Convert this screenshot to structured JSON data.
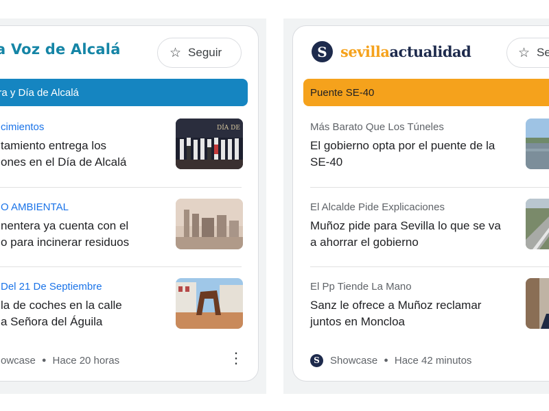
{
  "card1": {
    "brand": "a Voz de Alcalá",
    "follow_label": "Seguir",
    "topic": "era y Día de Alcalá",
    "articles": [
      {
        "kicker": "cimientos",
        "headline_line1": "tamiento entrega los",
        "headline_line2": "ones en el Día de Alcalá",
        "thumb": "award-ceremony-photo"
      },
      {
        "kicker": "O AMBIENTAL",
        "headline_line1": "nentera ya cuenta con el",
        "headline_line2": "o para incinerar residuos",
        "thumb": "cement-plant-photo"
      },
      {
        "kicker": "Del 21 De Septiembre",
        "headline_line1": "la de coches en la calle",
        "headline_line2": "a Señora del Águila",
        "thumb": "sculpture-street-photo"
      }
    ],
    "footer": {
      "source": "owcase",
      "time": "Hace 20 horas"
    }
  },
  "card2": {
    "brand_logo_letter": "S",
    "brand_part1": "sevilla",
    "brand_part2": "actualidad",
    "follow_label": "Se",
    "topic": "Puente SE-40",
    "articles": [
      {
        "kicker": "Más Barato Que Los Túneles",
        "headline_line1": "El gobierno opta por el puente de la",
        "headline_line2": "SE-40",
        "thumb": "river-bridge-photo"
      },
      {
        "kicker": "El Alcalde Pide Explicaciones",
        "headline_line1": "Muñoz pide para Sevilla lo que se va",
        "headline_line2": "a ahorrar el gobierno",
        "thumb": "highway-aerial-photo"
      },
      {
        "kicker": "El Pp Tiende La Mano",
        "headline_line1": "Sanz le ofrece a Muñoz reclamar",
        "headline_line2": "juntos en Moncloa",
        "thumb": "politician-portrait-photo"
      }
    ],
    "footer": {
      "source_icon_letter": "S",
      "source": "Showcase",
      "time": "Hace 42 minutos"
    }
  },
  "icons": {
    "follow": "star-outline-icon",
    "more": "more-vert-icon"
  },
  "colors": {
    "card1_accent": "#1585c1",
    "card1_kicker": "#1a73e8",
    "card2_accent": "#f5a21c",
    "card2_brand_navy": "#1d2a4c",
    "card2_kicker": "#5f6368"
  }
}
